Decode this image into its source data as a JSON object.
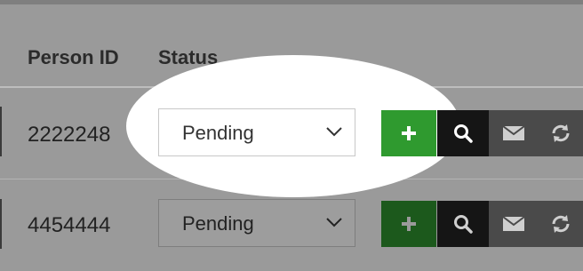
{
  "table": {
    "headers": {
      "person_id": "Person ID",
      "status": "Status"
    },
    "rows": [
      {
        "person_id": "2222248",
        "status": "Pending"
      },
      {
        "person_id": "4454444",
        "status": "Pending"
      }
    ]
  },
  "icons": {
    "add": "plus-icon",
    "search": "search-icon",
    "mail": "mail-icon",
    "sync": "refresh-icon",
    "dropdown": "chevron-down-icon"
  },
  "colors": {
    "add_button": "#2f9a2f",
    "add_button_dim": "#1c591c",
    "search_button": "#151515",
    "mail_button": "#4a4a4a",
    "overlay": "#9a9a9a",
    "spotlight": "#ffffff"
  }
}
